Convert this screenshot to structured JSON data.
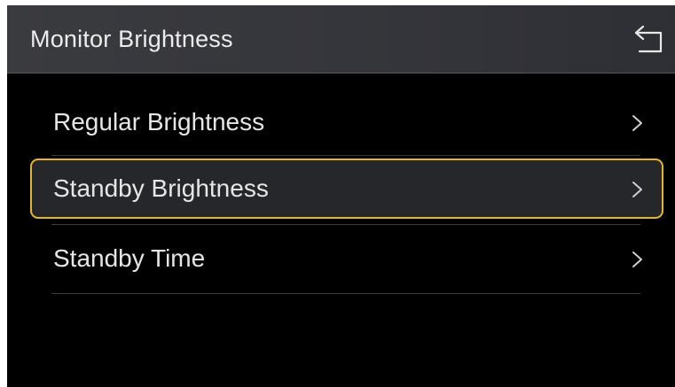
{
  "header": {
    "title": "Monitor Brightness",
    "back_icon": "back-return-icon"
  },
  "menu": {
    "items": [
      {
        "label": "Regular Brightness",
        "icon": "chevron-right-icon",
        "selected": false
      },
      {
        "label": "Standby Brightness",
        "icon": "chevron-right-icon",
        "selected": true
      },
      {
        "label": "Standby Time",
        "icon": "chevron-right-icon",
        "selected": false
      }
    ]
  },
  "colors": {
    "background": "#000000",
    "header_background": "#36373b",
    "text": "#e6e6e6",
    "selection_border": "#e6b530",
    "selection_fill": "#26272b",
    "divider": "#3a3a3d"
  }
}
